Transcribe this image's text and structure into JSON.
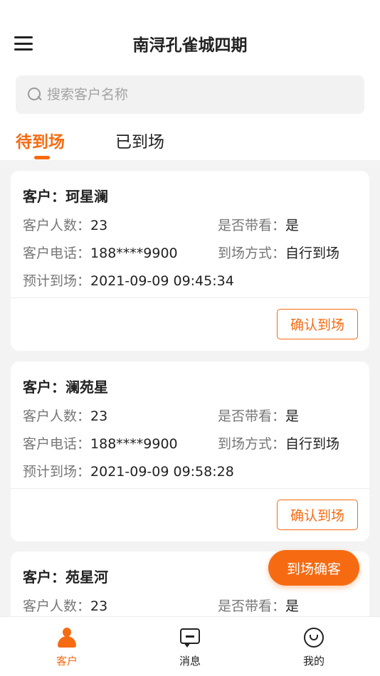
{
  "header": {
    "title": "南浔孔雀城四期"
  },
  "search": {
    "placeholder": "搜索客户名称"
  },
  "tabs": [
    {
      "label": "待到场",
      "active": true
    },
    {
      "label": "已到场",
      "active": false
    }
  ],
  "labels": {
    "customer": "客户：",
    "count": "客户人数：",
    "phone": "客户电话：",
    "escort": "是否带看：",
    "method": "到场方式：",
    "eta": "预计到场：",
    "confirm": "确认到场"
  },
  "cards": [
    {
      "name": "珂星澜",
      "count": "23",
      "phone": "188****9900",
      "escort": "是",
      "method": "自行到场",
      "eta": "2021-09-09 09:45:34"
    },
    {
      "name": "澜苑星",
      "count": "23",
      "phone": "188****9900",
      "escort": "是",
      "method": "自行到场",
      "eta": "2021-09-09 09:58:28"
    },
    {
      "name": "苑星河",
      "count": "23",
      "escort": "是"
    }
  ],
  "fab": {
    "label": "到场确客"
  },
  "nav": [
    {
      "label": "客户",
      "icon": "person-icon",
      "active": true
    },
    {
      "label": "消息",
      "icon": "message-icon",
      "active": false
    },
    {
      "label": "我的",
      "icon": "smile-icon",
      "active": false
    }
  ],
  "colors": {
    "accent": "#f66b12",
    "background": "#f3f3f3"
  }
}
